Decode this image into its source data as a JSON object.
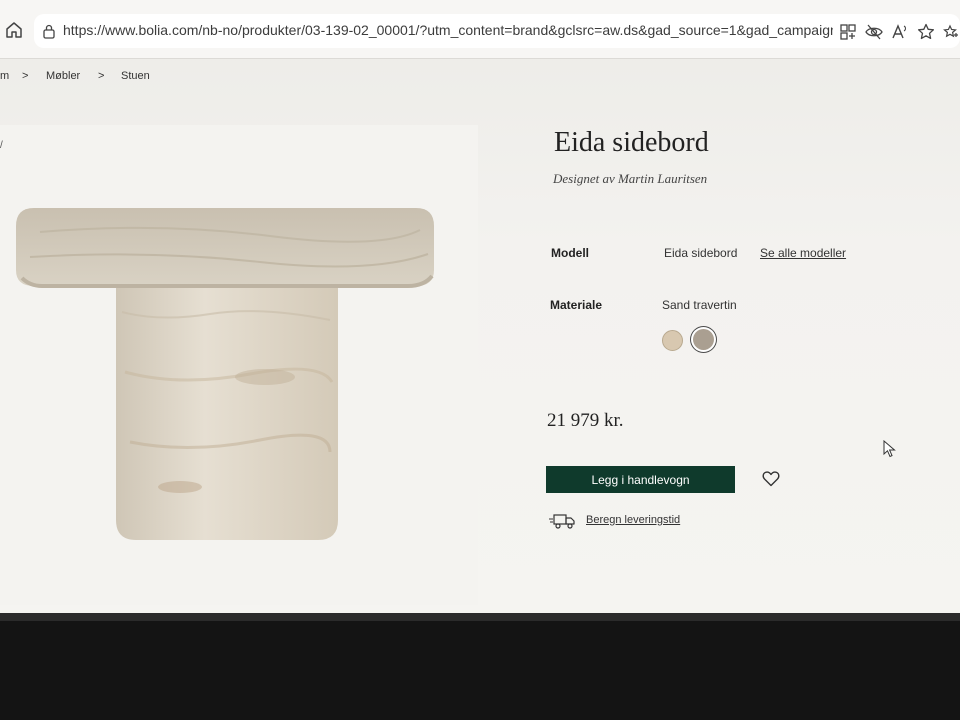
{
  "browser": {
    "url": "https://www.bolia.com/nb-no/produkter/03-139-02_00001/?utm_content=brand&gclsrc=aw.ds&gad_source=1&gad_campaignid..."
  },
  "breadcrumb": {
    "first": "m",
    "items": [
      "Møbler",
      "Stuen"
    ],
    "separator": ">"
  },
  "product": {
    "title": "Eida sidebord",
    "designer": "Designet av Martin Lauritsen",
    "model_label": "Modell",
    "model_value": "Eida sidebord",
    "all_models_link": "Se alle modeller",
    "material_label": "Materiale",
    "material_value": "Sand travertin",
    "price": "21 979 kr.",
    "add_to_cart": "Legg i handlevogn",
    "delivery_link": "Beregn leveringstid"
  },
  "image_panel_mark": "/",
  "colors": {
    "cart_button": "#0f3a2c",
    "swatch_sand": "#d8c8b0",
    "swatch_grey": "#aa9f91"
  }
}
